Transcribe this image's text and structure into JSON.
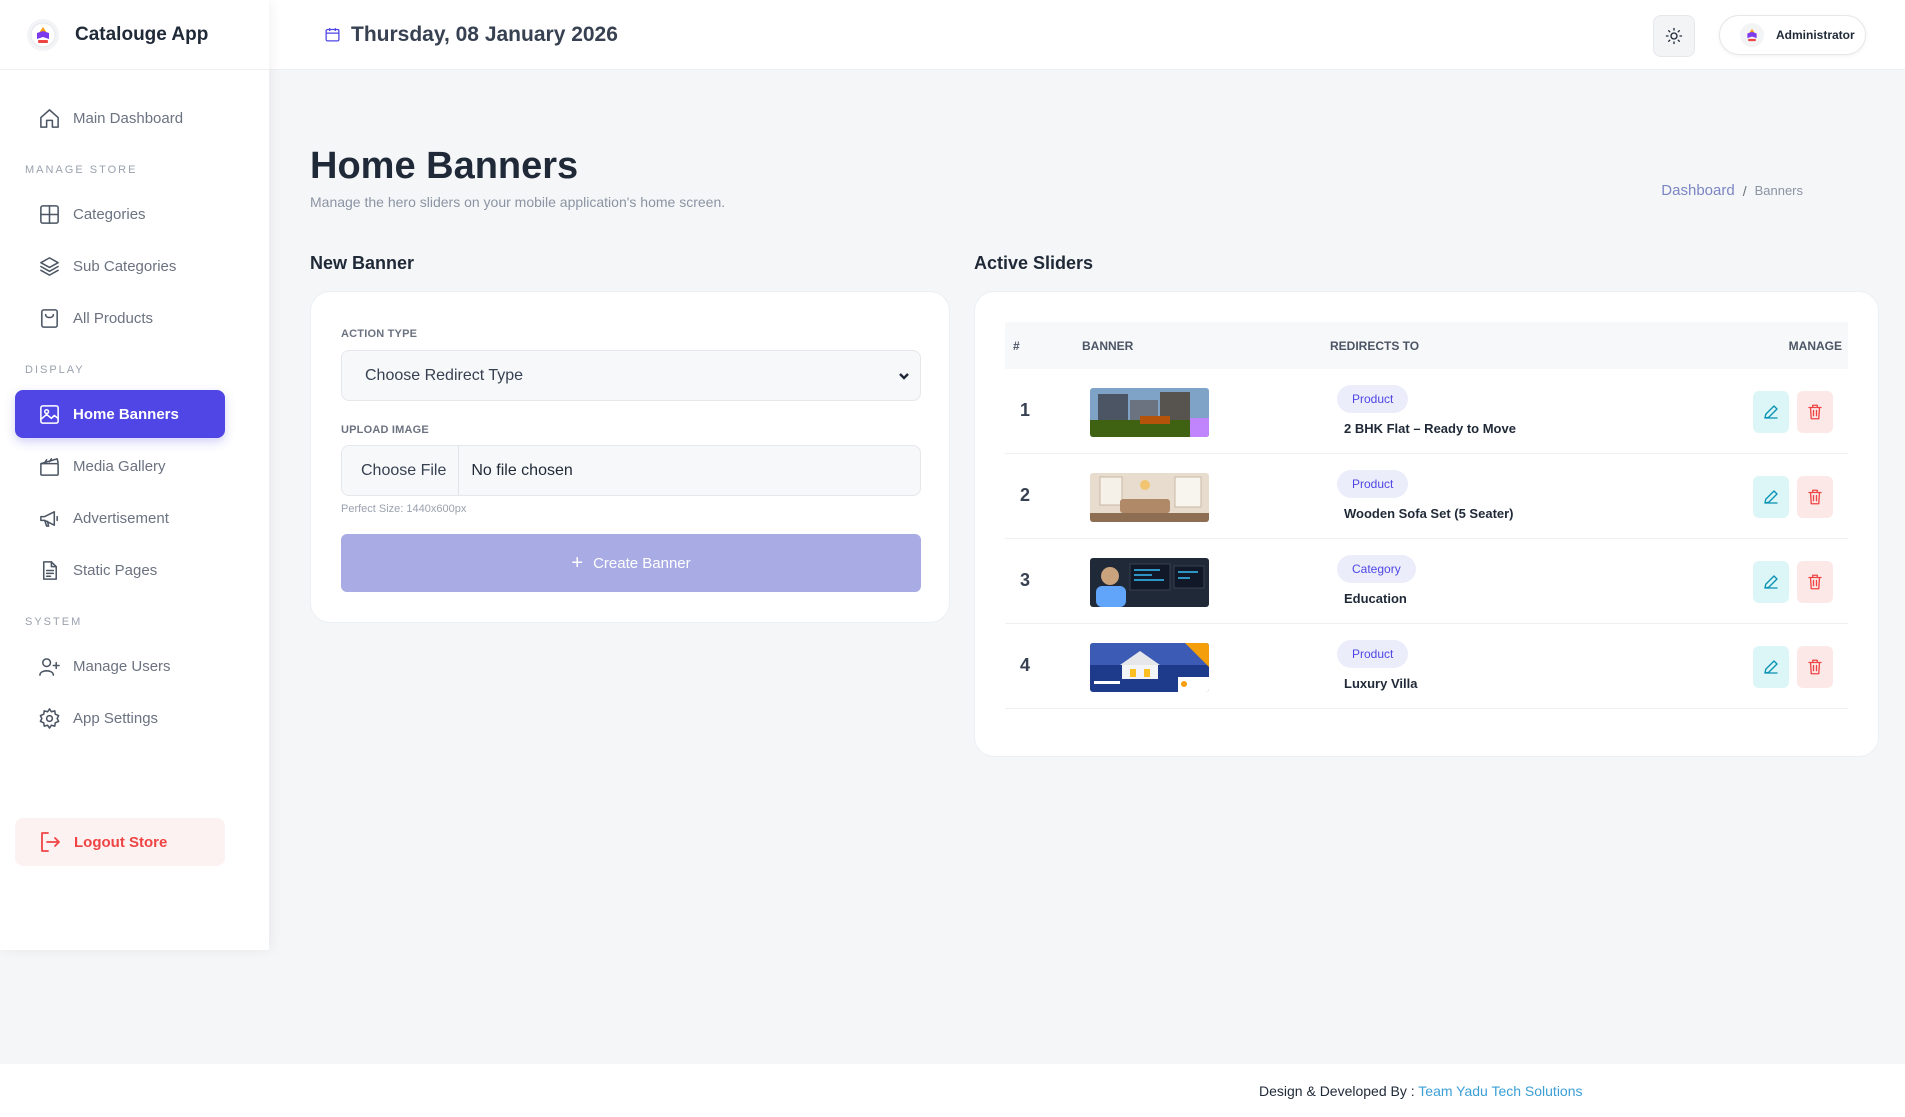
{
  "app": {
    "name": "Catalouge App"
  },
  "header": {
    "date": "Thursday, 08 January 2026",
    "user": "Administrator"
  },
  "sidebar": {
    "main_item": "Main Dashboard",
    "sections": [
      {
        "label": "MANAGE STORE",
        "items": [
          "Categories",
          "Sub Categories",
          "All Products"
        ]
      },
      {
        "label": "DISPLAY",
        "items": [
          "Home Banners",
          "Media Gallery",
          "Advertisement",
          "Static Pages"
        ]
      },
      {
        "label": "SYSTEM",
        "items": [
          "Manage Users",
          "App Settings"
        ]
      }
    ],
    "active": "Home Banners",
    "logout": "Logout Store"
  },
  "page": {
    "title": "Home Banners",
    "subtitle": "Manage the hero sliders on your mobile application's home screen.",
    "breadcrumb": {
      "link": "Dashboard",
      "separator": "/",
      "current": "Banners"
    }
  },
  "new_banner": {
    "title": "New Banner",
    "action_type_label": "ACTION TYPE",
    "action_type_value": "Choose Redirect Type",
    "upload_label": "UPLOAD IMAGE",
    "file_button": "Choose File",
    "file_name": "No file chosen",
    "hint": "Perfect Size: 1440x600px",
    "submit": "Create Banner"
  },
  "active_sliders": {
    "title": "Active Sliders",
    "columns": [
      "#",
      "BANNER",
      "REDIRECTS TO",
      "MANAGE"
    ],
    "rows": [
      {
        "num": "1",
        "type": "Product",
        "target": "2 BHK Flat – Ready to Move",
        "thumb": "apartment-building"
      },
      {
        "num": "2",
        "type": "Product",
        "target": "Wooden Sofa Set (5 Seater)",
        "thumb": "living-room"
      },
      {
        "num": "3",
        "type": "Category",
        "target": "Education",
        "thumb": "person-at-computer"
      },
      {
        "num": "4",
        "type": "Product",
        "target": "Luxury Villa",
        "thumb": "villa-ad"
      }
    ]
  },
  "footer": {
    "prefix": "Design & Developed By : ",
    "company": "Team Yadu Tech Solutions"
  },
  "colors": {
    "accent": "#4f46e5",
    "danger": "#ef4444",
    "info": "#0891b2",
    "muted": "#8b94a3"
  }
}
